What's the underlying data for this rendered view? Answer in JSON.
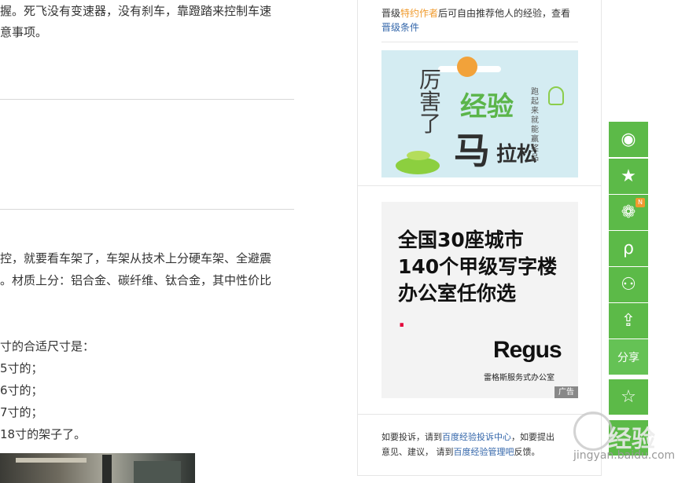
{
  "article": {
    "lines": [
      "握。死飞没有变速器，没有刹车，靠蹬踏来控制车速",
      "意事项。",
      "控，就要看车架了，车架从技术上分硬车架、全避震",
      "。材质上分：铝合金、碳纤维、钛合金，其中性价比",
      "寸的合适尺寸是：",
      "5寸的；",
      "6寸的；",
      "7寸的；",
      "18寸的架子了。"
    ]
  },
  "sidebar": {
    "tip": {
      "prefix": "晋级",
      "highlight": "特约作者",
      "suffix": "后可自由推荐他人的经验，查看",
      "link": "晋级条件"
    },
    "banner1": {
      "title_left": "厉害了",
      "title_green": "经验",
      "title_big": "马",
      "title_big2": "拉松",
      "subtitle": "跑起来就能赢奖品"
    },
    "banner2": {
      "headline": [
        "全国30座城市",
        "140个甲级写字楼",
        "办公室任你选"
      ],
      "brand": "Regus",
      "brand_sub": "雷格斯服务式办公室",
      "ad_label": "广告"
    },
    "complain": {
      "part1": "如要投诉，请到",
      "link1": "百度经验投诉中心",
      "part2": "，如要提出",
      "part3": "意见、建议，  请到",
      "link2": "百度经验管理吧",
      "part4": "反馈。"
    }
  },
  "share": {
    "buttons": [
      {
        "icon": "weibo-icon",
        "glyph": "◉"
      },
      {
        "icon": "qzone-star-icon",
        "glyph": "★"
      },
      {
        "icon": "wechat-icon",
        "glyph": "❁",
        "badge": "N"
      },
      {
        "icon": "tencent-weibo-icon",
        "glyph": "ρ"
      },
      {
        "icon": "renren-icon",
        "glyph": "⚇"
      },
      {
        "icon": "upload-share-icon",
        "glyph": "⇪"
      }
    ],
    "label": "分享",
    "favorite_glyph": "☆"
  },
  "watermark": {
    "big": "经验",
    "url": "jingyan.baidu.com"
  },
  "colors": {
    "share_green": "#5cba48",
    "link_blue": "#3366aa",
    "highlight_orange": "#f09a2c",
    "regus_red": "#e3003a"
  }
}
